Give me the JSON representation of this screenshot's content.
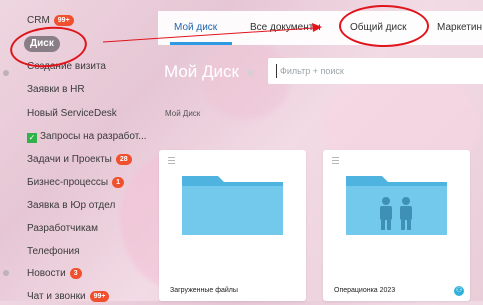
{
  "sidebar": {
    "items": [
      {
        "label": "CRM",
        "badge": "99+"
      },
      {
        "label": "Диск",
        "badge": ""
      },
      {
        "label": "Создание визита",
        "badge": ""
      },
      {
        "label": "Заявки в HR",
        "badge": ""
      },
      {
        "label": "Новый ServiceDesk",
        "badge": ""
      },
      {
        "label": "Запросы на разработ...",
        "badge": ""
      },
      {
        "label": "Задачи и Проекты",
        "badge": "28"
      },
      {
        "label": "Бизнес-процессы",
        "badge": "1"
      },
      {
        "label": "Заявка в Юр отдел",
        "badge": ""
      },
      {
        "label": "Разработчикам",
        "badge": ""
      },
      {
        "label": "Телефония",
        "badge": ""
      },
      {
        "label": "Новости",
        "badge": "3"
      },
      {
        "label": "Чат и звонки",
        "badge": "99+"
      }
    ],
    "check_glyph": "✓"
  },
  "tabs": [
    {
      "label": "Мой диск"
    },
    {
      "label": "Все документы"
    },
    {
      "label": "Общий диск"
    },
    {
      "label": "Маркетин"
    }
  ],
  "header": {
    "title": "Мой Диск",
    "star_glyph": "★",
    "search_placeholder": "Фильтр + поиск"
  },
  "breadcrumb": "Мой Диск",
  "files": [
    {
      "name": "Загруженные файлы",
      "icon": "folder-icon"
    },
    {
      "name": "Операционка 2023",
      "icon": "shared-folder-icon",
      "shared_glyph": "⚇"
    }
  ],
  "colors": {
    "accent": "#2f9ae4",
    "active_tab": "#2067b0",
    "badge": "#f0502d",
    "folder": "#72c9ec",
    "folder_tab": "#4fb3df",
    "annotation": "#e0141b"
  }
}
